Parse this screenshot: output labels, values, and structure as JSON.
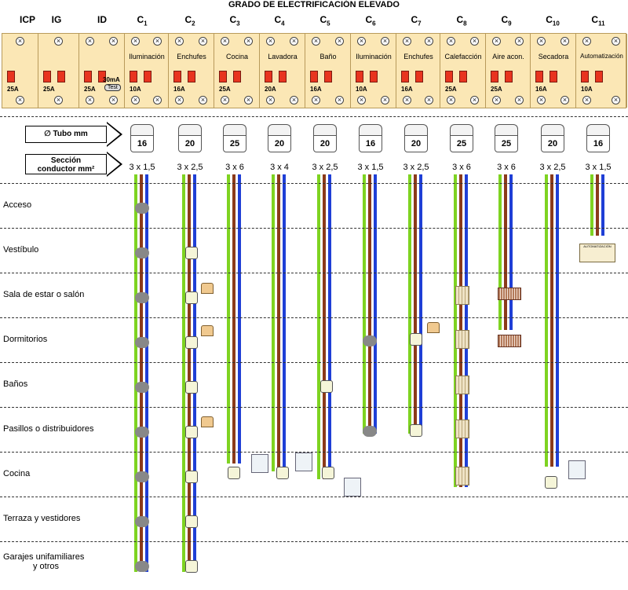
{
  "title": "GRADO DE ELECTRIFICACIÓN ELEVADO",
  "columns": [
    {
      "key": "ICP",
      "label": "ICP",
      "sub": ""
    },
    {
      "key": "IG",
      "label": "IG",
      "sub": ""
    },
    {
      "key": "ID",
      "label": "ID",
      "sub": ""
    },
    {
      "key": "C1",
      "label": "C",
      "sub": "1"
    },
    {
      "key": "C2",
      "label": "C",
      "sub": "2"
    },
    {
      "key": "C3",
      "label": "C",
      "sub": "3"
    },
    {
      "key": "C4",
      "label": "C",
      "sub": "4"
    },
    {
      "key": "C5",
      "label": "C",
      "sub": "5"
    },
    {
      "key": "C6",
      "label": "C",
      "sub": "6"
    },
    {
      "key": "C7",
      "label": "C",
      "sub": "7"
    },
    {
      "key": "C8",
      "label": "C",
      "sub": "8"
    },
    {
      "key": "C9",
      "label": "C",
      "sub": "9"
    },
    {
      "key": "C10",
      "label": "C",
      "sub": "10"
    },
    {
      "key": "C11",
      "label": "C",
      "sub": "11"
    }
  ],
  "panel": {
    "icp_amp": "25A",
    "ig_amp": "25A",
    "id_amp": "25A",
    "id_sensitivity": "30mA",
    "id_test": "Test",
    "circuits": [
      {
        "name": "Iluminación",
        "amp": "10A"
      },
      {
        "name": "Enchufes",
        "amp": "16A"
      },
      {
        "name": "Cocina",
        "amp": "25A"
      },
      {
        "name": "Lavadora",
        "amp": "20A"
      },
      {
        "name": "Baño",
        "amp": "16A"
      },
      {
        "name": "Iluminación",
        "amp": "10A"
      },
      {
        "name": "Enchufes",
        "amp": "16A"
      },
      {
        "name": "Calefacción",
        "amp": "25A"
      },
      {
        "name": "Aire acon.",
        "amp": "25A"
      },
      {
        "name": "Secadora",
        "amp": "16A"
      },
      {
        "name": "Automatización",
        "amp": "10A"
      }
    ]
  },
  "labels": {
    "tubo": "∅ Tubo mm",
    "seccion_1": "Sección",
    "seccion_2": "conductor mm²"
  },
  "tubes": [
    "16",
    "20",
    "25",
    "20",
    "20",
    "16",
    "20",
    "25",
    "25",
    "20",
    "16"
  ],
  "sections": [
    "3 x 1,5",
    "3 x 2,5",
    "3 x 6",
    "3 x 4",
    "3 x 2,5",
    "3 x 1,5",
    "3 x 2,5",
    "3 x 6",
    "3 x 6",
    "3 x 2,5",
    "3 x 1,5"
  ],
  "rooms": [
    {
      "line1": "Acceso",
      "line2": ""
    },
    {
      "line1": "Vestíbulo",
      "line2": ""
    },
    {
      "line1": "Sala de estar o salón",
      "line2": ""
    },
    {
      "line1": "Dormitorios",
      "line2": ""
    },
    {
      "line1": "Baños",
      "line2": ""
    },
    {
      "line1": "Pasillos o distribuidores",
      "line2": ""
    },
    {
      "line1": "Cocina",
      "line2": ""
    },
    {
      "line1": "Terraza  y  vestidores",
      "line2": ""
    },
    {
      "line1": "Garajes unifamiliares",
      "line2": "y otros"
    }
  ],
  "automation_box_text": "AUTOMATIZACIÓN",
  "colors": {
    "green": "#7ed321",
    "brown": "#8b3a1a",
    "blue": "#1f3fd6",
    "panel": "#fbe7b5"
  }
}
